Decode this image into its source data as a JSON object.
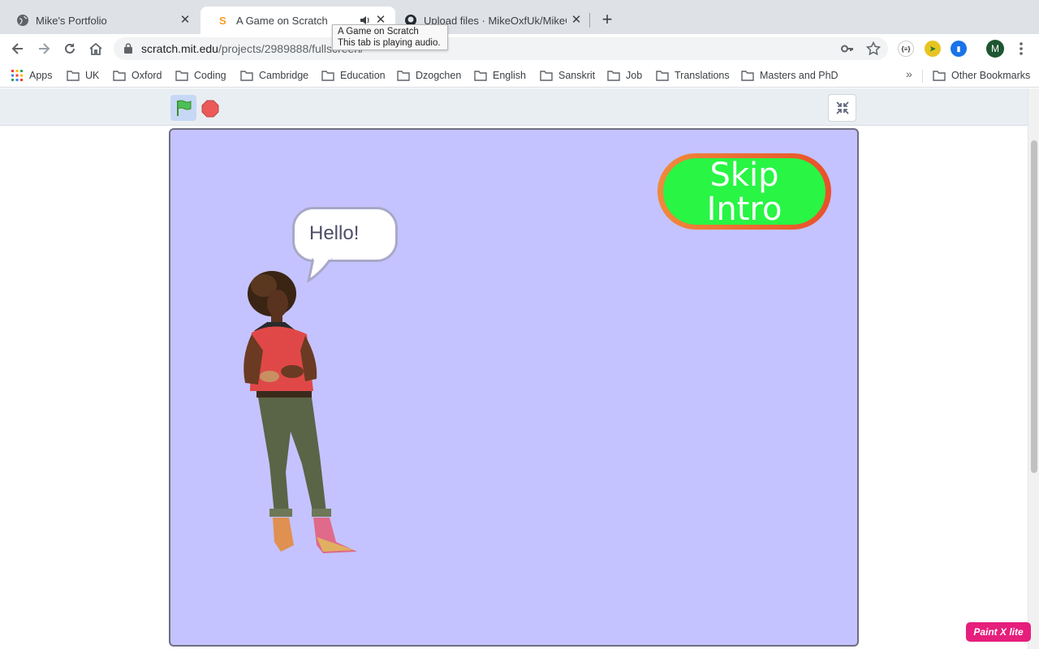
{
  "browser": {
    "tabs": [
      {
        "title": "Mike's Portfolio",
        "active": false,
        "icon": "globe-icon"
      },
      {
        "title": "A Game on Scratch",
        "active": true,
        "icon": "scratch-icon",
        "audio": true
      },
      {
        "title": "Upload files · MikeOxfUk/MikeOx",
        "active": false,
        "icon": "github-icon"
      }
    ],
    "tooltip": {
      "line1": "A Game on Scratch",
      "line2": "This tab is playing audio."
    },
    "url": {
      "host": "scratch.mit.edu",
      "path": "/projects/2989888/fullscreen/"
    },
    "profile_initial": "M",
    "bookmarks": [
      "Apps",
      "UK",
      "Oxford",
      "Coding",
      "Cambridge",
      "Education",
      "Dzogchen",
      "English",
      "Sanskrit",
      "Job",
      "Translations",
      "Masters and PhD"
    ],
    "other_bookmarks": "Other Bookmarks",
    "more_bookmarks": "»"
  },
  "scratch": {
    "stage_color": "#c4c3ff",
    "skip_button": {
      "line1": "Skip",
      "line2": "Intro"
    },
    "speech_bubble": "Hello!"
  },
  "badge": "Paint X lite"
}
